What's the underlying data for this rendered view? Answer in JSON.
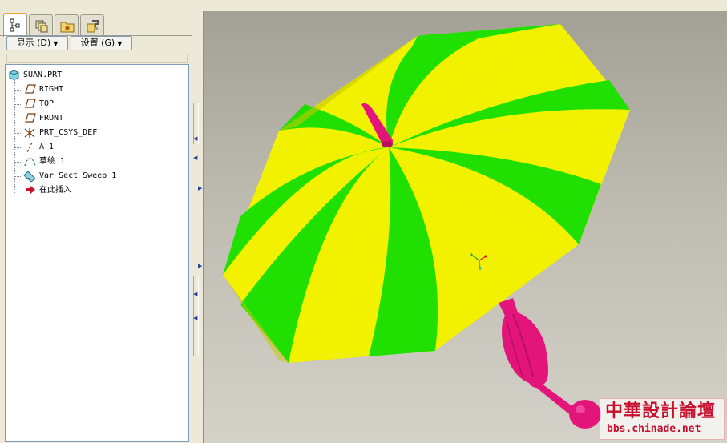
{
  "tabs": [
    {
      "icon": "model-tree-icon",
      "active": true
    },
    {
      "icon": "layers-icon",
      "active": false
    },
    {
      "icon": "favorites-folder-icon",
      "active": false
    },
    {
      "icon": "connections-icon",
      "active": false
    }
  ],
  "toolbar": {
    "show_label": "显示 (D)",
    "settings_label": "设置 (G)"
  },
  "tree": {
    "root": "SUAN.PRT",
    "items": [
      {
        "label": "RIGHT",
        "icon": "datum-plane-icon"
      },
      {
        "label": "TOP",
        "icon": "datum-plane-icon"
      },
      {
        "label": "FRONT",
        "icon": "datum-plane-icon"
      },
      {
        "label": "PRT_CSYS_DEF",
        "icon": "coordinate-system-icon"
      },
      {
        "label": "A_1",
        "icon": "datum-axis-icon"
      },
      {
        "label": "草绘 1",
        "icon": "sketch-icon"
      },
      {
        "label": "Var Sect Sweep 1",
        "icon": "sweep-feature-icon"
      },
      {
        "label": "在此插入",
        "icon": "insert-here-arrow-icon"
      }
    ]
  },
  "model": {
    "name": "umbrella",
    "colors": {
      "panel_a": "#1fe000",
      "panel_b": "#f2f200",
      "handle": "#e4157a"
    }
  },
  "watermark": {
    "title": "中華設計論壇",
    "url": "bbs.chinade.net"
  }
}
